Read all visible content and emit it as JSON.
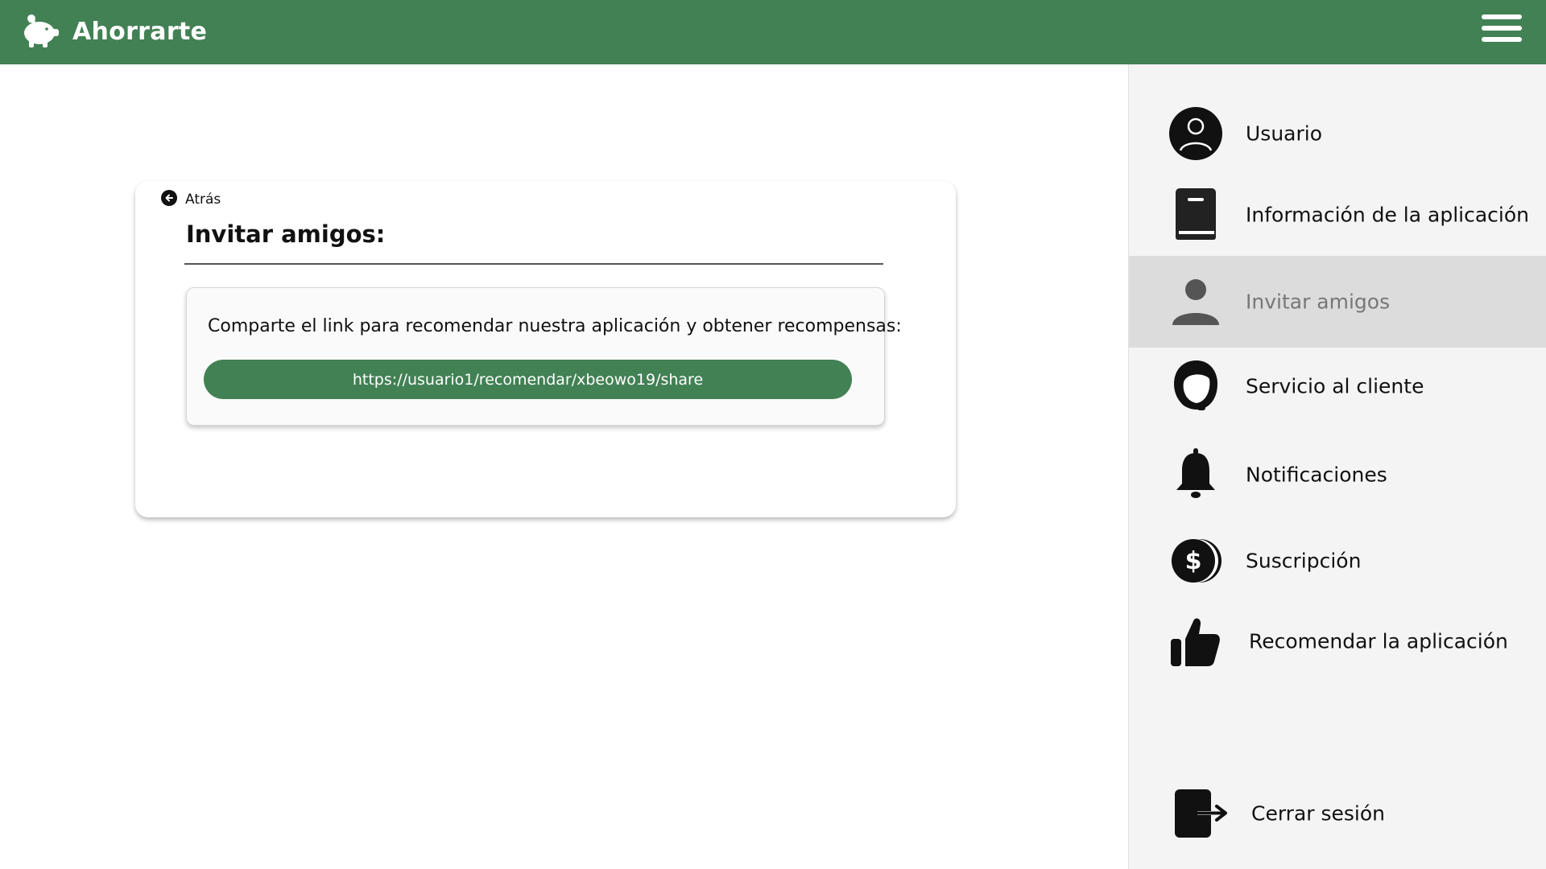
{
  "app": {
    "title": "Ahorrarte"
  },
  "page": {
    "back_label": "Atrás",
    "title": "Invitar amigos:",
    "share_text": "Comparte el link para recomendar nuestra aplicación y obtener recompensas:",
    "share_link": "https://usuario1/recomendar/xbeowo19/share"
  },
  "sidebar": {
    "items": [
      {
        "label": "Usuario",
        "icon": "user-circle-icon"
      },
      {
        "label": "Información de la aplicación",
        "icon": "book-icon"
      },
      {
        "label": "Invitar amigos",
        "icon": "person-icon",
        "active": true
      },
      {
        "label": "Servicio al cliente",
        "icon": "headset-icon"
      },
      {
        "label": "Notificaciones",
        "icon": "bell-icon"
      },
      {
        "label": "Suscripción",
        "icon": "dollar-coin-icon"
      },
      {
        "label": "Recomendar la aplicación",
        "icon": "thumbs-up-icon"
      }
    ],
    "logout": {
      "label": "Cerrar sesión",
      "icon": "logout-icon"
    }
  },
  "colors": {
    "brand": "#428154",
    "active_bg": "#dcdcdc",
    "sidebar_bg": "#f4f4f4"
  }
}
